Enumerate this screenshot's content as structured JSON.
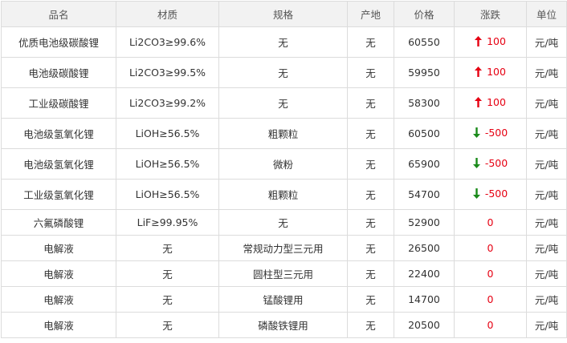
{
  "table": {
    "headers": [
      "品名",
      "材质",
      "规格",
      "产地",
      "价格",
      "涨跌",
      "单位"
    ],
    "rows": [
      {
        "name": "优质电池级碳酸锂",
        "material": "Li2CO3≥99.6%",
        "spec": "无",
        "origin": "无",
        "price": "60550",
        "change": "100",
        "direction": "up",
        "unit": "元/吨"
      },
      {
        "name": "电池级碳酸锂",
        "material": "Li2CO3≥99.5%",
        "spec": "无",
        "origin": "无",
        "price": "59950",
        "change": "100",
        "direction": "up",
        "unit": "元/吨"
      },
      {
        "name": "工业级碳酸锂",
        "material": "Li2CO3≥99.2%",
        "spec": "无",
        "origin": "无",
        "price": "58300",
        "change": "100",
        "direction": "up",
        "unit": "元/吨"
      },
      {
        "name": "电池级氢氧化锂",
        "material": "LiOH≥56.5%",
        "spec": "粗颗粒",
        "origin": "无",
        "price": "60500",
        "change": "-500",
        "direction": "down",
        "unit": "元/吨"
      },
      {
        "name": "电池级氢氧化锂",
        "material": "LiOH≥56.5%",
        "spec": "微粉",
        "origin": "无",
        "price": "65900",
        "change": "-500",
        "direction": "down",
        "unit": "元/吨"
      },
      {
        "name": "工业级氢氧化锂",
        "material": "LiOH≥56.5%",
        "spec": "粗颗粒",
        "origin": "无",
        "price": "54700",
        "change": "-500",
        "direction": "down",
        "unit": "元/吨"
      },
      {
        "name": "六氟磷酸锂",
        "material": "LiF≥99.95%",
        "spec": "无",
        "origin": "无",
        "price": "52900",
        "change": "0",
        "direction": "none",
        "unit": "元/吨"
      },
      {
        "name": "电解液",
        "material": "无",
        "spec": "常规动力型三元用",
        "origin": "无",
        "price": "26500",
        "change": "0",
        "direction": "none",
        "unit": "元/吨"
      },
      {
        "name": "电解液",
        "material": "无",
        "spec": "圆柱型三元用",
        "origin": "无",
        "price": "22400",
        "change": "0",
        "direction": "none",
        "unit": "元/吨"
      },
      {
        "name": "电解液",
        "material": "无",
        "spec": "锰酸锂用",
        "origin": "无",
        "price": "14700",
        "change": "0",
        "direction": "none",
        "unit": "元/吨"
      },
      {
        "name": "电解液",
        "material": "无",
        "spec": "磷酸铁锂用",
        "origin": "无",
        "price": "20500",
        "change": "0",
        "direction": "none",
        "unit": "元/吨"
      }
    ]
  },
  "colors": {
    "up_arrow": "#e60012",
    "down_arrow": "#1a8a1a",
    "change_text": "#e60012"
  },
  "icons": {
    "up": "arrow-up-icon",
    "down": "arrow-down-icon"
  }
}
